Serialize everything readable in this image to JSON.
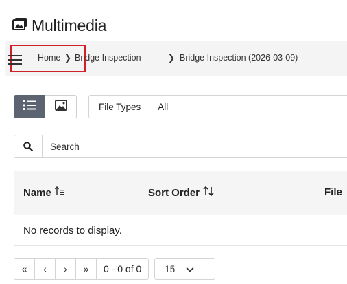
{
  "title": {
    "text": "Multimedia",
    "icon": "photo-album-icon"
  },
  "breadcrumb": {
    "menu_icon": "hamburger-menu-icon",
    "items": [
      {
        "label": "Home"
      },
      {
        "label": "Bridge Inspection"
      },
      {
        "label": "Bridge Inspection (2026-03-09)"
      }
    ],
    "separator": "❯",
    "highlight_color": "#d0202a"
  },
  "toolbar": {
    "view_list_icon": "list-view-icon",
    "view_gallery_icon": "image-gallery-icon",
    "file_types_label": "File Types",
    "file_types_value": "All"
  },
  "search": {
    "placeholder": "Search",
    "value": ""
  },
  "grid": {
    "columns": [
      {
        "label": "Name",
        "sort_icon": "sort-alpha-asc-icon"
      },
      {
        "label": "Sort Order",
        "sort_icon": "sort-updown-icon"
      },
      {
        "label": "File"
      }
    ],
    "empty_message": "No records to display."
  },
  "pager": {
    "first": "«",
    "prev": "‹",
    "next": "›",
    "last": "»",
    "info": "0 - 0 of 0",
    "page_size": "15"
  },
  "colors": {
    "active_toggle": "#5b6470",
    "breadcrumb_bg": "#f4f4f4",
    "header_bg": "#f5f5f5",
    "border": "#d4d4d4"
  }
}
